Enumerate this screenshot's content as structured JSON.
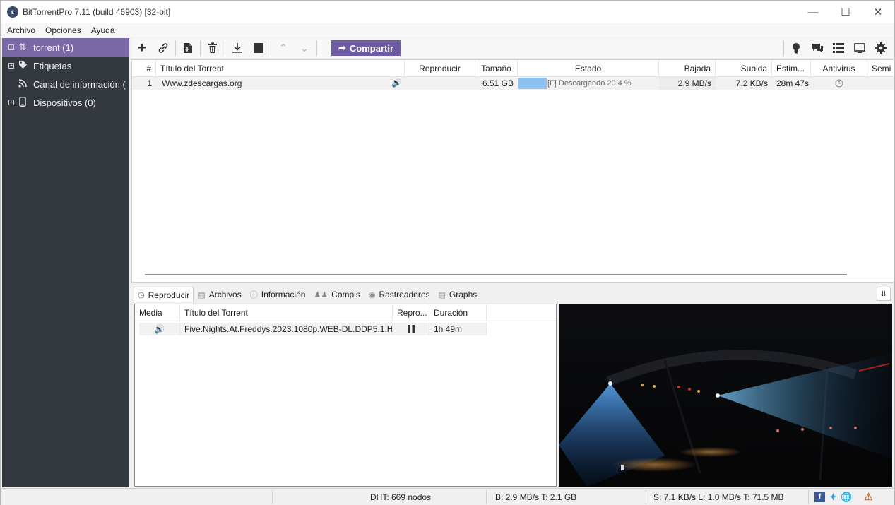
{
  "window": {
    "title": "BitTorrentPro 7.11  (build 46903) [32-bit]"
  },
  "menu": [
    "Archivo",
    "Opciones",
    "Ayuda"
  ],
  "sidebar": {
    "items": [
      {
        "label": "torrent (1)",
        "icon": "up-down-arrows-icon"
      },
      {
        "label": "Etiquetas",
        "icon": "tag-icon"
      },
      {
        "label": "Canal de información (",
        "icon": "rss-feed-icon"
      },
      {
        "label": "Dispositivos (0)",
        "icon": "phone-device-icon"
      }
    ]
  },
  "toolbar": {
    "share_label": "Compartir"
  },
  "torrent_list": {
    "headers": [
      "#",
      "Título del Torrent",
      "Reproducir",
      "Tamaño",
      "Estado",
      "Bajada",
      "Subida",
      "Estim...",
      "Antivirus",
      "Semi"
    ],
    "rows": [
      {
        "num": "1",
        "title": "Www.zdescargas.org",
        "size": "6.51 GB",
        "status": "[F] Descargando 20.4 %",
        "progress": 20.4,
        "down": "2.9 MB/s",
        "up": "7.2 KB/s",
        "eta": "28m 47s"
      }
    ]
  },
  "tabs": [
    "Reproducir",
    "Archivos",
    "Información",
    "Compis",
    "Rastreadores",
    "Graphs"
  ],
  "media_table": {
    "headers": [
      "Media",
      "Título del Torrent",
      "Repro...",
      "Duración"
    ],
    "rows": [
      {
        "title": "Five.Nights.At.Freddys.2023.1080p.WEB-DL.DDP5.1.H...",
        "duration": "1h 49m"
      }
    ]
  },
  "statusbar": {
    "dht": "DHT: 669 nodos",
    "down": "B: 2.9 MB/s T: 2.1 GB",
    "up": "S: 7.1 KB/s L: 1.0 MB/s T: 71.5 MB"
  },
  "colors": {
    "accent": "#7a67a6",
    "share": "#6d5ba3",
    "sidebar": "#34393f",
    "progress": "#8ec0f2"
  }
}
